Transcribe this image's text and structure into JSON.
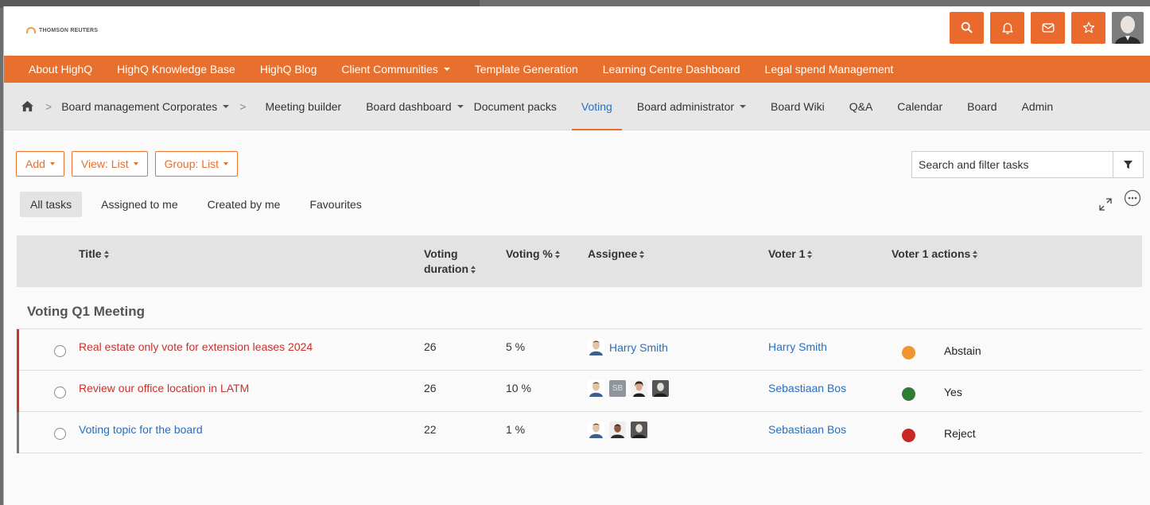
{
  "brand": {
    "logo_text": "THOMSON REUTERS"
  },
  "colors": {
    "accent": "#e8702e",
    "link": "#2a6ebb",
    "overdue": "#c8322d"
  },
  "header_actions": [
    {
      "name": "search-icon"
    },
    {
      "name": "bell-icon"
    },
    {
      "name": "mail-icon"
    },
    {
      "name": "star-icon"
    }
  ],
  "topnav": {
    "items": [
      {
        "label": "About HighQ",
        "dropdown": false
      },
      {
        "label": "HighQ Knowledge Base",
        "dropdown": false
      },
      {
        "label": "HighQ Blog",
        "dropdown": false
      },
      {
        "label": "Client Communities",
        "dropdown": true
      },
      {
        "label": "Template Generation",
        "dropdown": false
      },
      {
        "label": "Learning Centre Dashboard",
        "dropdown": false
      },
      {
        "label": "Legal spend Management",
        "dropdown": false
      }
    ]
  },
  "subnav": {
    "site": "Board management Corporates",
    "items": [
      {
        "label": "Meeting builder",
        "dropdown": false,
        "active": false
      },
      {
        "label": "Board dashboard",
        "dropdown": true,
        "active": false
      },
      {
        "label": "Document packs",
        "dropdown": false,
        "active": false
      },
      {
        "label": "Voting",
        "dropdown": false,
        "active": true
      },
      {
        "label": "Board administrator",
        "dropdown": true,
        "active": false
      },
      {
        "label": "Board Wiki",
        "dropdown": false,
        "active": false
      },
      {
        "label": "Q&A",
        "dropdown": false,
        "active": false
      },
      {
        "label": "Calendar",
        "dropdown": false,
        "active": false
      },
      {
        "label": "Board",
        "dropdown": false,
        "active": false
      },
      {
        "label": "Admin",
        "dropdown": false,
        "active": false
      }
    ]
  },
  "toolbar": {
    "add_label": "Add",
    "view_label": "View: List",
    "group_label": "Group: List",
    "search_placeholder": "Search and filter tasks"
  },
  "tabs": [
    {
      "label": "All tasks",
      "active": true
    },
    {
      "label": "Assigned to me",
      "active": false
    },
    {
      "label": "Created by me",
      "active": false
    },
    {
      "label": "Favourites",
      "active": false
    }
  ],
  "table": {
    "columns": {
      "title": "Title",
      "duration_line1": "Voting",
      "duration_line2": "duration",
      "percent": "Voting %",
      "assignee": "Assignee",
      "voter": "Voter 1",
      "actions": "Voter 1 actions"
    },
    "group": "Voting Q1 Meeting",
    "rows": [
      {
        "title": "Real estate only vote for extension leases 2024",
        "title_color": "red",
        "bar_color": "#c8322d",
        "duration": "26",
        "percent": "5 %",
        "assignee_name": "Harry Smith",
        "avatars": [
          "person-a"
        ],
        "voter": "Harry Smith",
        "action_color": "#f0952f",
        "action": "Abstain"
      },
      {
        "title": "Review our office location in LATM",
        "title_color": "red",
        "bar_color": "#c8322d",
        "duration": "26",
        "percent": "10 %",
        "assignee_name": "",
        "avatars": [
          "person-a",
          "SB",
          "person-b",
          "person-c"
        ],
        "voter": "Sebastiaan Bos",
        "action_color": "#2e7d32",
        "action": "Yes"
      },
      {
        "title": "Voting topic for the board",
        "title_color": "blue",
        "bar_color": "#777777",
        "duration": "22",
        "percent": "1 %",
        "assignee_name": "",
        "avatars": [
          "person-a",
          "person-d",
          "person-c"
        ],
        "voter": "Sebastiaan Bos",
        "action_color": "#c62828",
        "action": "Reject"
      }
    ]
  }
}
